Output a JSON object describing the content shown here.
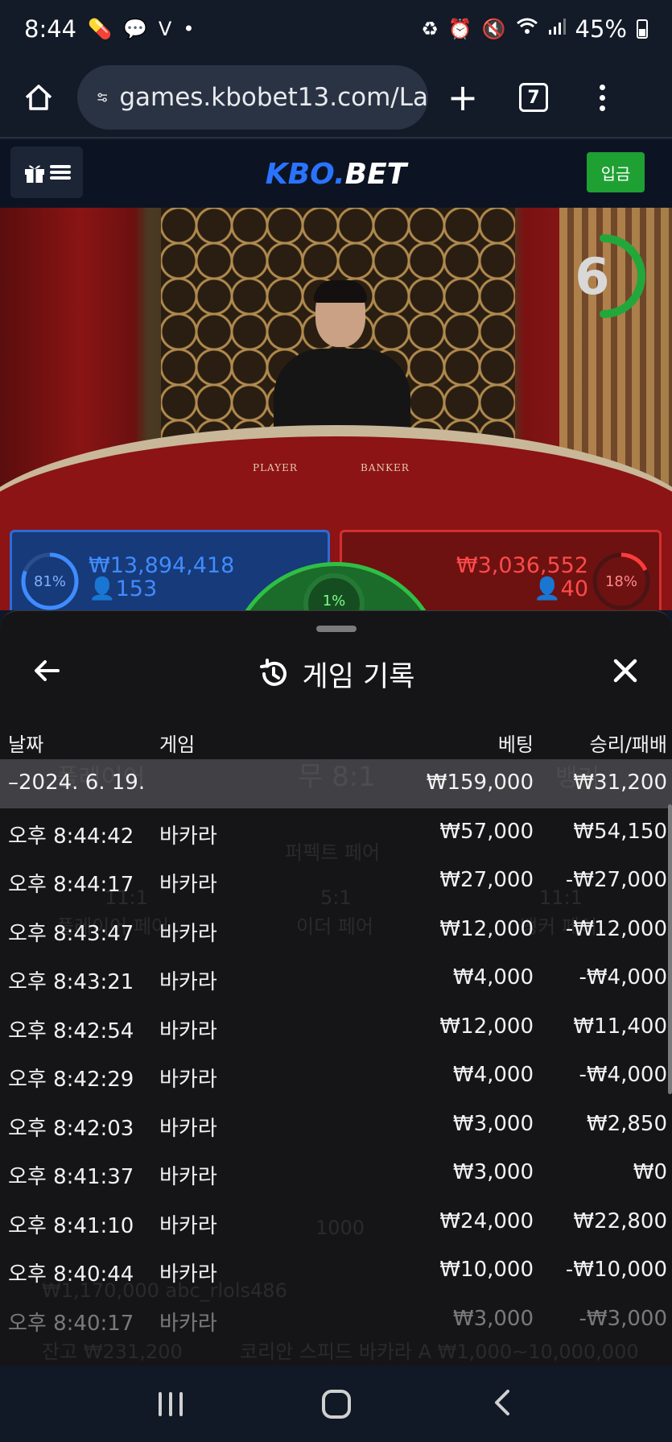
{
  "status_bar": {
    "time": "8:44",
    "battery": "45%"
  },
  "browser": {
    "url": "games.kbobet13.com/La",
    "tab_count": "7"
  },
  "site": {
    "logo_kbo": "KBO",
    "logo_dot": ".",
    "logo_bet": "BET",
    "deposit_label": "입금"
  },
  "game": {
    "countdown": "6",
    "table_player_label": "PLAYER",
    "table_banker_label": "BANKER",
    "player": {
      "percent": "81%",
      "amount": "₩13,894,418",
      "count": "153",
      "percent_value": 0.81
    },
    "banker": {
      "percent": "18%",
      "amount": "₩3,036,552",
      "count": "40",
      "percent_value": 0.18
    },
    "tie": {
      "percent": "1%"
    },
    "colors": {
      "player": "#2f6ad6",
      "banker": "#d32f2f",
      "tie": "#2fbf45"
    }
  },
  "history": {
    "title": "게임 기록",
    "columns": {
      "date": "날짜",
      "game": "게임",
      "bet": "베팅",
      "result": "승리/패배"
    },
    "summary": {
      "date": "–2024. 6. 19.",
      "bet": "₩159,000",
      "result": "₩31,200"
    },
    "rows": [
      {
        "time": "오후 8:44:42",
        "game": "바카라",
        "bet": "₩57,000",
        "result": "₩54,150"
      },
      {
        "time": "오후 8:44:17",
        "game": "바카라",
        "bet": "₩27,000",
        "result": "-₩27,000"
      },
      {
        "time": "오후 8:43:47",
        "game": "바카라",
        "bet": "₩12,000",
        "result": "-₩12,000"
      },
      {
        "time": "오후 8:43:21",
        "game": "바카라",
        "bet": "₩4,000",
        "result": "-₩4,000"
      },
      {
        "time": "오후 8:42:54",
        "game": "바카라",
        "bet": "₩12,000",
        "result": "₩11,400"
      },
      {
        "time": "오후 8:42:29",
        "game": "바카라",
        "bet": "₩4,000",
        "result": "-₩4,000"
      },
      {
        "time": "오후 8:42:03",
        "game": "바카라",
        "bet": "₩3,000",
        "result": "₩2,850"
      },
      {
        "time": "오후 8:41:37",
        "game": "바카라",
        "bet": "₩3,000",
        "result": "₩0"
      },
      {
        "time": "오후 8:41:10",
        "game": "바카라",
        "bet": "₩24,000",
        "result": "₩22,800"
      },
      {
        "time": "오후 8:40:44",
        "game": "바카라",
        "bet": "₩10,000",
        "result": "-₩10,000"
      },
      {
        "time": "오후 8:40:17",
        "game": "바카라",
        "bet": "₩3,000",
        "result": "-₩3,000"
      }
    ]
  },
  "background_overlay": {
    "player_pair_label": "플레이어",
    "tie_odds": "무 8:1",
    "banker_label": "뱅커",
    "perfect_pair": "퍼펙트 페어",
    "either_odds": "5:1",
    "either_pair": "이더 페어",
    "banker_pair_odds": "11:1",
    "banker_pair": "뱅커 페어",
    "player_pair_odds": "11:1",
    "player_pair": "플레이어 페어",
    "chip": "1000",
    "user_line": "₩1,170,000 abc_rlols486",
    "balance": "잔고 ₩231,200",
    "table_name": "코리안 스피드 바카라 A ₩1,000~10,000,000"
  }
}
